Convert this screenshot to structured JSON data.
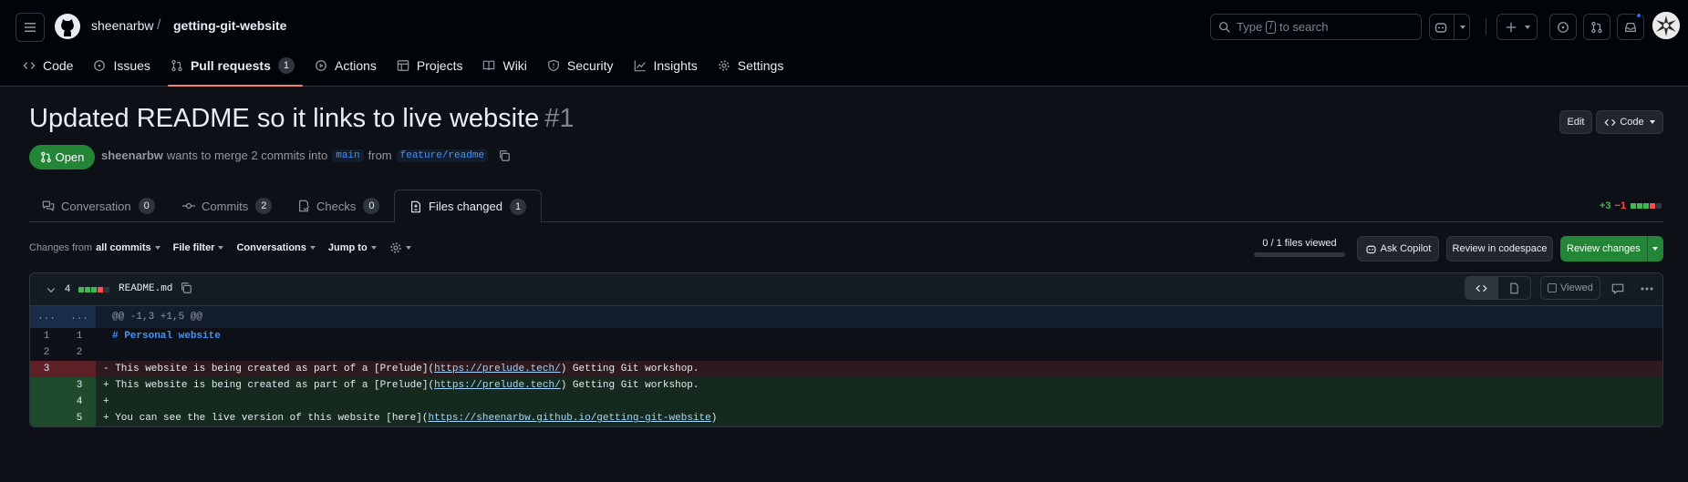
{
  "repo": {
    "owner": "sheenarbw",
    "sep": "/",
    "name": "getting-git-website"
  },
  "search": {
    "text_before": "Type",
    "key": "/",
    "text_after": "to search"
  },
  "nav": [
    {
      "id": "code",
      "label": "Code",
      "icon": "code-icon"
    },
    {
      "id": "issues",
      "label": "Issues",
      "icon": "issue-icon"
    },
    {
      "id": "pull-requests",
      "label": "Pull requests",
      "icon": "pull-request-icon",
      "count": "1",
      "active": true
    },
    {
      "id": "actions",
      "label": "Actions",
      "icon": "play-icon"
    },
    {
      "id": "projects",
      "label": "Projects",
      "icon": "table-icon"
    },
    {
      "id": "wiki",
      "label": "Wiki",
      "icon": "book-icon"
    },
    {
      "id": "security",
      "label": "Security",
      "icon": "shield-icon"
    },
    {
      "id": "insights",
      "label": "Insights",
      "icon": "graph-icon"
    },
    {
      "id": "settings",
      "label": "Settings",
      "icon": "gear-icon"
    }
  ],
  "pr": {
    "title": "Updated README so it links to live website",
    "number": "#1",
    "edit_label": "Edit",
    "code_label": "Code",
    "state": "Open",
    "author": "sheenarbw",
    "meta_text": "wants to merge 2 commits into",
    "base": "main",
    "from_text": "from",
    "head": "feature/readme"
  },
  "tabs": [
    {
      "label": "Conversation",
      "count": "0",
      "icon": "comment-discussion-icon"
    },
    {
      "label": "Commits",
      "count": "2",
      "icon": "commit-icon"
    },
    {
      "label": "Checks",
      "count": "0",
      "icon": "checklist-icon"
    },
    {
      "label": "Files changed",
      "count": "1",
      "icon": "file-diff-icon",
      "active": true
    }
  ],
  "diffstat": {
    "additions": "+3",
    "deletions": "−1"
  },
  "toolbar": {
    "changes_from": "Changes from",
    "all_commits": "all commits",
    "file_filter": "File filter",
    "conversations": "Conversations",
    "jump_to": "Jump to",
    "files_viewed": "0 / 1 files viewed",
    "files_viewed_fraction": 0,
    "ask_copilot": "Ask Copilot",
    "review_codespace": "Review in codespace",
    "review_changes": "Review changes"
  },
  "file": {
    "changes": "4",
    "name": "README.md",
    "viewed_label": "Viewed",
    "hunk": "@@ -1,3 +1,5 @@",
    "lines": [
      {
        "type": "norm",
        "left": "1",
        "right": "1",
        "text": "# Personal website"
      },
      {
        "type": "norm",
        "left": "2",
        "right": "2",
        "text": ""
      },
      {
        "type": "del",
        "left": "3",
        "right": "",
        "prefix": "- ",
        "pre": "This website is being created as part of a [Prelude](",
        "link": "https://prelude.tech/",
        "post": ") Getting Git workshop."
      },
      {
        "type": "add",
        "left": "",
        "right": "3",
        "prefix": "+ ",
        "pre": "This website is being created as part of a [Prelude](",
        "link": "https://prelude.tech/",
        "post": ") Getting Git workshop."
      },
      {
        "type": "add",
        "left": "",
        "right": "4",
        "prefix": "+",
        "pre": "",
        "link": "",
        "post": ""
      },
      {
        "type": "add",
        "left": "",
        "right": "5",
        "prefix": "+ ",
        "pre": "You can see the live version of this website [here](",
        "link": "https://sheenarbw.github.io/getting-git-website",
        "post": ")"
      }
    ],
    "hunk_left": "...",
    "hunk_right": "..."
  },
  "colors": {
    "add": "#3fb950",
    "del": "#f85149",
    "accent": "#4493f8",
    "open": "#238636"
  }
}
